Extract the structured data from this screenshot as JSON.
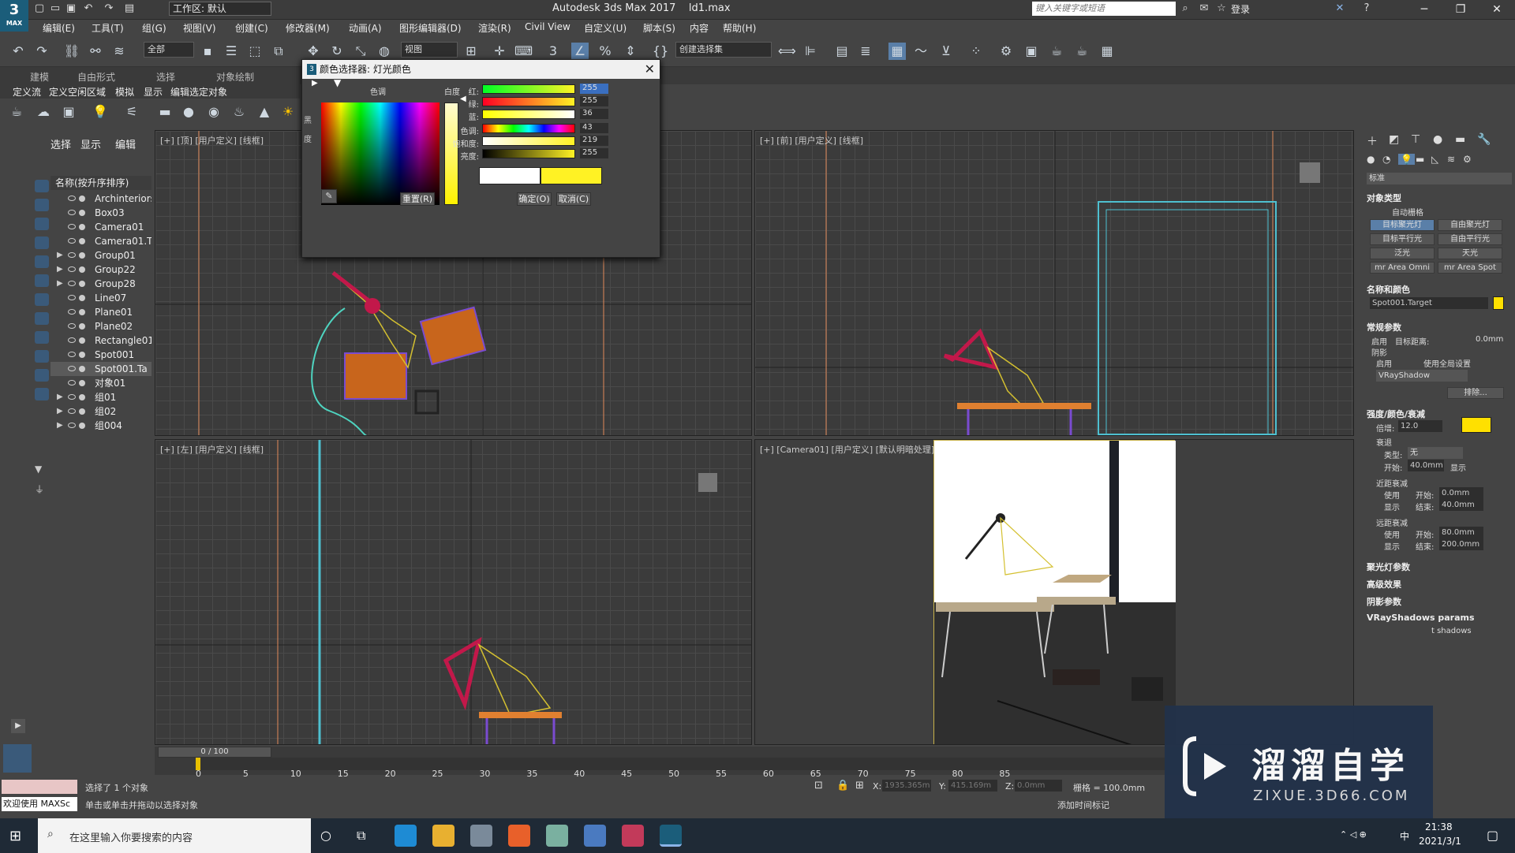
{
  "app": {
    "logo_text": "3",
    "logo_sub": "MAX",
    "title": "Autodesk 3ds Max 2017",
    "file": "ld1.max",
    "workspace": "工作区: 默认",
    "search_placeholder": "键入关键字或短语",
    "login": "登录"
  },
  "menu": [
    "编辑(E)",
    "工具(T)",
    "组(G)",
    "视图(V)",
    "创建(C)",
    "修改器(M)",
    "动画(A)",
    "图形编辑器(D)",
    "渲染(R)",
    "Civil View",
    "自定义(U)",
    "脚本(S)",
    "内容",
    "帮助(H)"
  ],
  "toolbar": {
    "filter": "全部",
    "view": "视图",
    "selection_set": "创建选择集"
  },
  "ribbon_tabs": [
    "建模",
    "自由形式",
    "选择",
    "对象绘制"
  ],
  "sub_tabs": [
    "定义流",
    "定义空闲区域",
    "模拟",
    "显示",
    "编辑选定对象"
  ],
  "scene": {
    "tabs": [
      "选择",
      "显示",
      "编辑"
    ],
    "header": "名称(按升序排序)",
    "items": [
      {
        "name": "Archinteriors",
        "arrow": false,
        "sel": false
      },
      {
        "name": "Box03",
        "arrow": false,
        "sel": false
      },
      {
        "name": "Camera01",
        "arrow": false,
        "sel": false
      },
      {
        "name": "Camera01.T",
        "arrow": false,
        "sel": false
      },
      {
        "name": "Group01",
        "arrow": true,
        "sel": false
      },
      {
        "name": "Group22",
        "arrow": true,
        "sel": false
      },
      {
        "name": "Group28",
        "arrow": true,
        "sel": false
      },
      {
        "name": "Line07",
        "arrow": false,
        "sel": false
      },
      {
        "name": "Plane01",
        "arrow": false,
        "sel": false
      },
      {
        "name": "Plane02",
        "arrow": false,
        "sel": false
      },
      {
        "name": "Rectangle01",
        "arrow": false,
        "sel": false
      },
      {
        "name": "Spot001",
        "arrow": false,
        "sel": false
      },
      {
        "name": "Spot001.Ta",
        "arrow": false,
        "sel": true
      },
      {
        "name": "对象01",
        "arrow": false,
        "sel": false
      },
      {
        "name": "组01",
        "arrow": true,
        "sel": false
      },
      {
        "name": "组02",
        "arrow": true,
        "sel": false
      },
      {
        "name": "组004",
        "arrow": true,
        "sel": false
      }
    ]
  },
  "viewports": {
    "top": "[+] [顶] [用户定义] [线框]",
    "front": "[+] [前] [用户定义] [线框]",
    "left": "[+] [左] [用户定义] [线框]",
    "camera": "[+] [Camera01] [用户定义] [默认明暗处理]"
  },
  "dialog": {
    "title": "颜色选择器: 灯光颜色",
    "hue_label": "色调",
    "white_label": "白度",
    "sliders": [
      {
        "label": "红:",
        "value": "255"
      },
      {
        "label": "绿:",
        "value": "255"
      },
      {
        "label": "蓝:",
        "value": "36"
      },
      {
        "label": "色调:",
        "value": "43"
      },
      {
        "label": "饱和度:",
        "value": "219"
      },
      {
        "label": "亮度:",
        "value": "255"
      }
    ],
    "reset": "重置(R)",
    "ok": "确定(O)",
    "cancel": "取消(C)",
    "side1": "黑",
    "side2": "度",
    "swatch_old": "#ffffff",
    "swatch_new": "#fff224"
  },
  "right_panel": {
    "dropdown": "标准",
    "object_type": "对象类型",
    "autogrid": "自动栅格",
    "buttons": [
      "目标聚光灯",
      "自由聚光灯",
      "目标平行光",
      "自由平行光",
      "泛光",
      "天光",
      "mr Area Omni",
      "mr Area Spot"
    ],
    "name_color": "名称和颜色",
    "object_name": "Spot001.Target",
    "general": "常规参数",
    "enable": "启用",
    "target_dist_label": "目标距离:",
    "target_dist": "0.0mm",
    "shadow": "阴影",
    "shadow_enable": "启用",
    "use_global": "使用全局设置",
    "shadow_type": "VRayShadow",
    "exclude": "排除...",
    "intensity": "强度/颜色/衰减",
    "multiplier_label": "倍增:",
    "multiplier": "12.0",
    "decay": "衰退",
    "type_label": "类型:",
    "type_value": "无",
    "start_label": "开始:",
    "start_value": "40.0mm",
    "show": "显示",
    "near_atten": "近距衰减",
    "use": "使用",
    "near_start": "0.0mm",
    "near_end": "40.0mm",
    "far_atten": "远距衰减",
    "far_start": "80.0mm",
    "far_end": "200.0mm",
    "start": "开始:",
    "end": "结束:",
    "spot_params": "聚光灯参数",
    "advanced": "高级效果",
    "shadow_params": "阴影参数",
    "vray_shadows": "VRayShadows params",
    "trans_shadows": "t shadows",
    "color": "#ffe000"
  },
  "timeline": {
    "frame": "0 / 100",
    "ticks": [
      "0",
      "5",
      "10",
      "15",
      "20",
      "25",
      "30",
      "35",
      "40",
      "45",
      "50",
      "55",
      "60",
      "65",
      "70",
      "75",
      "80",
      "85"
    ]
  },
  "status": {
    "selected": "选择了 1 个对象",
    "hint": "单击或单击并拖动以选择对象",
    "welcome": "欢迎使用 MAXSc",
    "x_label": "X:",
    "x": "1935.365m",
    "y_label": "Y:",
    "y": "415.169m",
    "z_label": "Z:",
    "z": "0.0mm",
    "grid": "栅格 = 100.0mm",
    "add_time_tag": "添加时间标记"
  },
  "taskbar": {
    "search": "在这里输入你要搜索的内容",
    "time": "21:38",
    "date": "2021/3/1",
    "lang": "中"
  },
  "watermark": {
    "title": "溜溜自学",
    "url": "ZIXUE.3D66.COM"
  }
}
